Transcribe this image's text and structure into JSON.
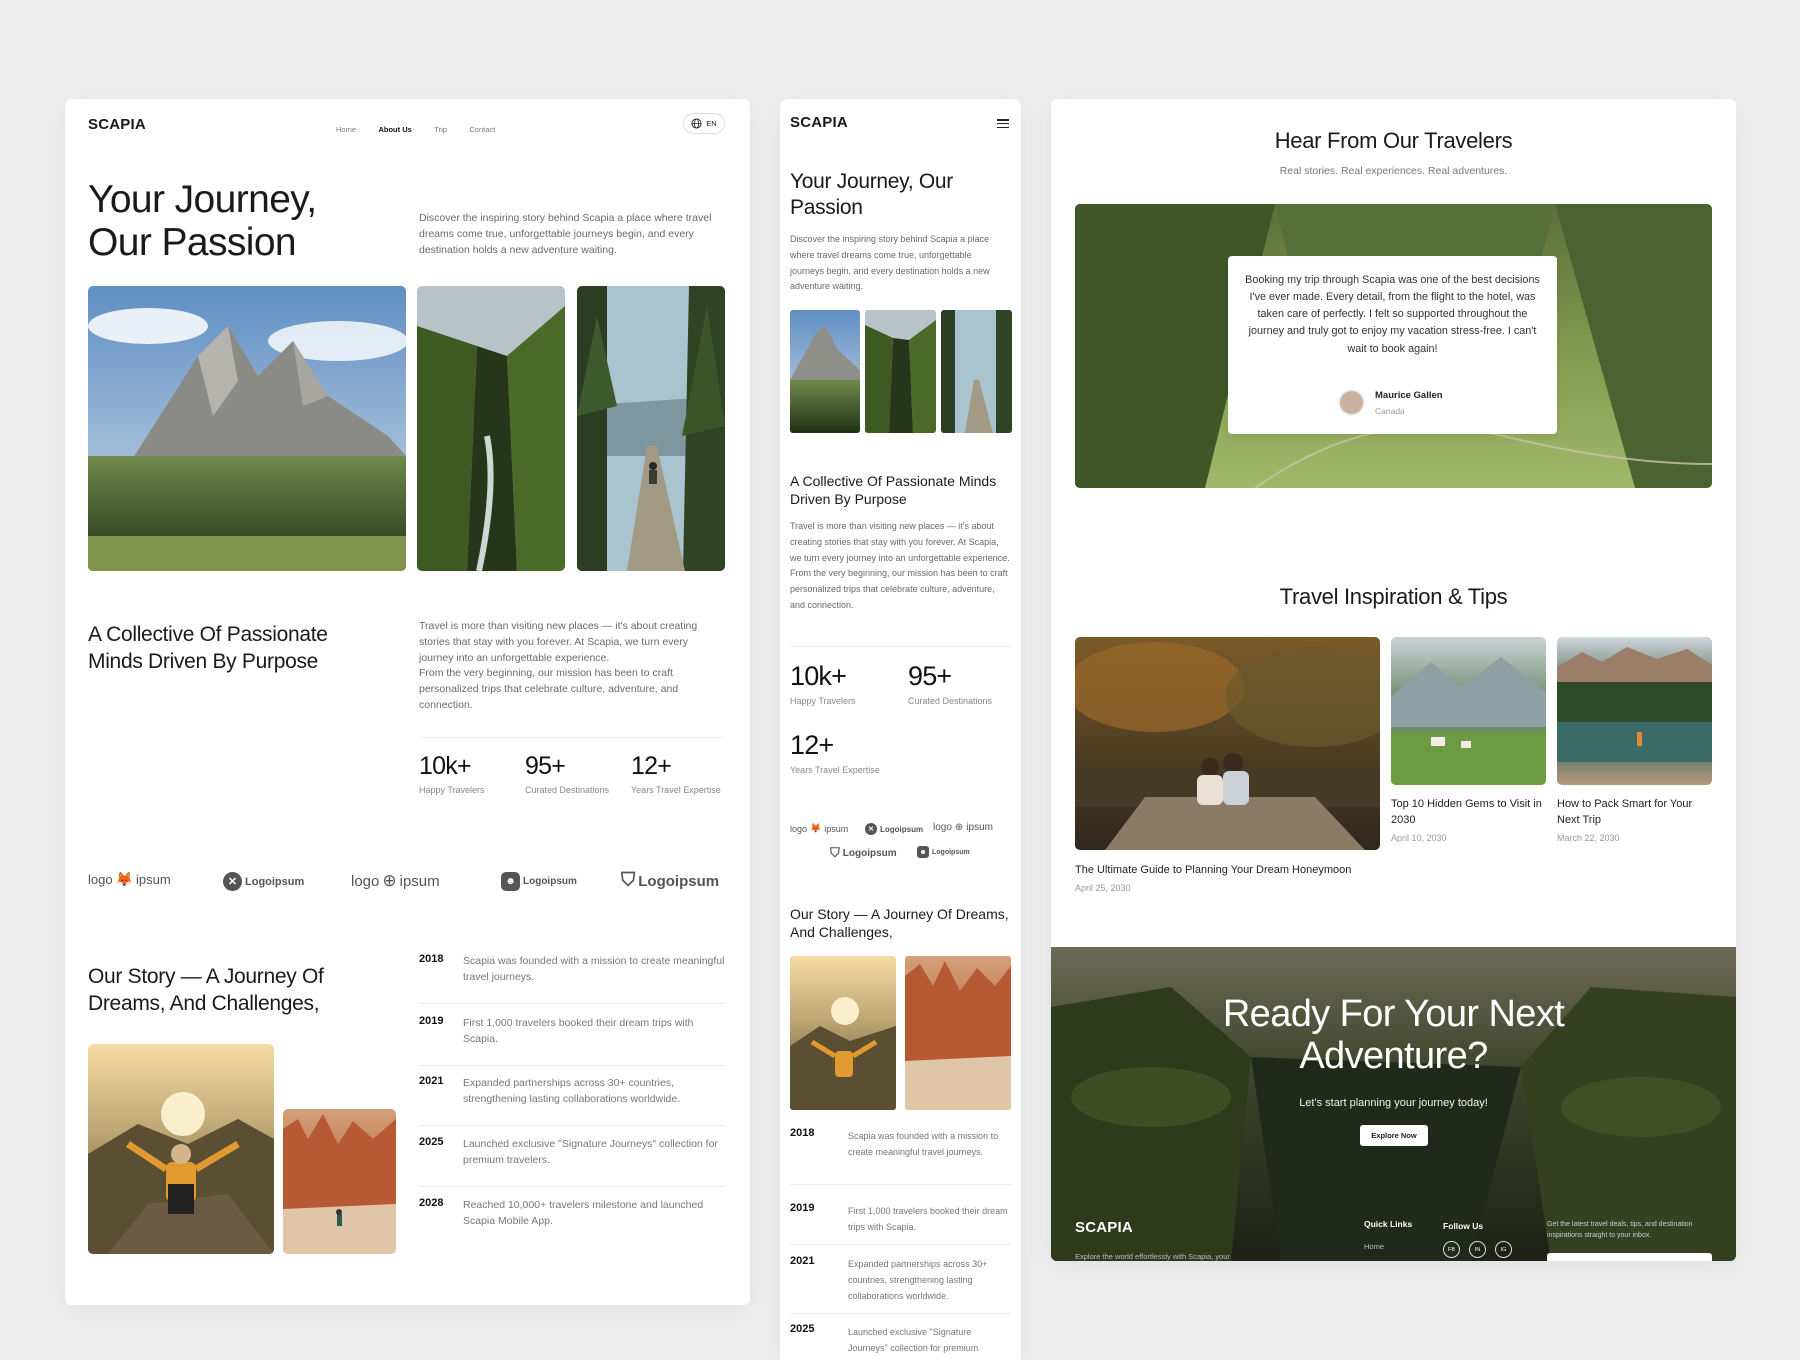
{
  "brand": "SCAPIA",
  "nav": {
    "items": [
      "Home",
      "About Us",
      "Trip",
      "Contact"
    ],
    "active": "About Us",
    "lang": "EN"
  },
  "hero": {
    "title_line1": "Your Journey,",
    "title_line2": "Our Passion",
    "mobile_title": "Your Journey, Our Passion",
    "description": "Discover the inspiring story behind Scapia a place where travel dreams come true, unforgettable journeys begin, and every destination holds a new adventure waiting."
  },
  "collective": {
    "title_line1": "A Collective Of Passionate",
    "title_line2": "Minds Driven By Purpose",
    "mobile_title": "A Collective Of Passionate Minds Driven By Purpose",
    "para1": "Travel is more than visiting new places — it's about creating stories that stay with you forever. At Scapia, we turn every journey into an unforgettable experience.",
    "para2": "From the very beginning, our mission has been to craft personalized trips that celebrate culture, adventure, and connection."
  },
  "stats": [
    {
      "value": "10k+",
      "label": "Happy Travelers"
    },
    {
      "value": "95+",
      "label": "Curated Destinations"
    },
    {
      "value": "12+",
      "label": "Years Travel Expertise"
    }
  ],
  "partner_logos": [
    "logo",
    "ipsum",
    "Logoipsum",
    "logo",
    "ipsum",
    "Logoipsum",
    "Logoipsum"
  ],
  "story": {
    "title_line1": "Our Story — A Journey Of",
    "title_line2": "Dreams, And Challenges,",
    "mobile_title": "Our Story — A Journey Of Dreams, And Challenges,",
    "timeline": [
      {
        "year": "2018",
        "text": "Scapia was founded with a mission to create meaningful travel journeys."
      },
      {
        "year": "2019",
        "text": "First 1,000 travelers booked their dream trips with Scapia."
      },
      {
        "year": "2021",
        "text": "Expanded partnerships across 30+ countries, strengthening lasting collaborations worldwide."
      },
      {
        "year": "2025",
        "text": "Launched exclusive \"Signature Journeys\" collection for premium travelers."
      },
      {
        "year": "2028",
        "text": "Reached 10,000+ travelers milestone and launched Scapia Mobile App."
      }
    ]
  },
  "testimonials": {
    "title": "Hear From Our Travelers",
    "subtitle": "Real stories. Real experiences. Real adventures.",
    "quote": "Booking my trip through Scapia was one of the best decisions I've ever made. Every detail, from the flight to the hotel, was taken care of perfectly. I felt so supported throughout the journey and truly got to enjoy my vacation stress-free. I can't wait to book again!",
    "author": "Maurice Gallen",
    "location": "Canada"
  },
  "inspiration": {
    "title": "Travel Inspiration & Tips",
    "posts": [
      {
        "title": "The Ultimate Guide to Planning Your Dream Honeymoon",
        "date": "April 25, 2030"
      },
      {
        "title": "Top 10 Hidden Gems to Visit in 2030",
        "date": "April 10, 2030"
      },
      {
        "title": "How to Pack Smart for Your Next Trip",
        "date": "March 22, 2030"
      }
    ]
  },
  "cta": {
    "title_line1": "Ready For Your Next",
    "title_line2": "Adventure?",
    "subtitle": "Let's start planning your journey today!",
    "button": "Explore Now"
  },
  "footer": {
    "tagline": "Explore the world effortlessly with Scapia, your",
    "quick_links_title": "Quick Links",
    "quick_link_home": "Home",
    "follow_title": "Follow Us",
    "socials": [
      "FB",
      "IN",
      "IG"
    ],
    "newsletter_line1": "Get the latest travel deals, tips, and destination",
    "newsletter_line2": "inspirations straight to your inbox."
  },
  "colors": {
    "text": "#1a1a1a",
    "muted": "#777777",
    "page_bg": "#eeeeee",
    "forest": "#3d5226"
  }
}
